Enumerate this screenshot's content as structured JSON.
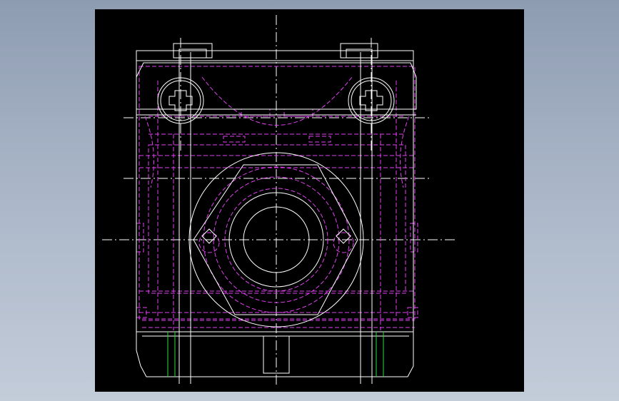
{
  "viewport": {
    "background": "#000000"
  },
  "drawing": {
    "colors": {
      "outline": "#ffffff",
      "hidden": "#e040f0",
      "center": "#ffffff",
      "accent": "#20e040"
    }
  }
}
